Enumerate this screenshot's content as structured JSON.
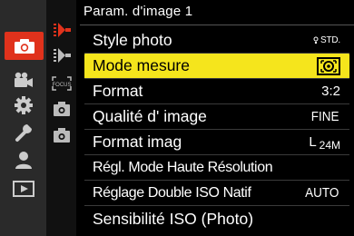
{
  "header": {
    "title": "Param. d'image 1"
  },
  "main_tabs": [
    {
      "icon": "camera-icon",
      "active": true
    },
    {
      "icon": "movie-camera-icon",
      "active": false
    },
    {
      "icon": "gear-icon",
      "active": false
    },
    {
      "icon": "wrench-icon",
      "active": false
    },
    {
      "icon": "person-icon",
      "active": false
    },
    {
      "icon": "playback-icon",
      "active": false
    }
  ],
  "sub_tabs": [
    {
      "icon": "image-settings-1-icon",
      "active": true
    },
    {
      "icon": "image-settings-2-icon",
      "active": false
    },
    {
      "icon": "focus-icon",
      "label": "FOCUS"
    },
    {
      "icon": "camera-small-icon",
      "active": false
    },
    {
      "icon": "camera-small-2-icon",
      "active": false
    }
  ],
  "menu": {
    "items": [
      {
        "label": "Style photo",
        "value": "STD."
      },
      {
        "label": "Mode mesure",
        "value_icon": "metering-icon"
      },
      {
        "label": "Format",
        "value": "3:2"
      },
      {
        "label": "Qualité d' image",
        "value": "FINE"
      },
      {
        "label": "Format imag",
        "value": "L",
        "value_sub": "24M"
      },
      {
        "label": "Régl. Mode Haute Résolution",
        "value": ""
      },
      {
        "label": "Réglage Double ISO Natif",
        "value": "AUTO"
      },
      {
        "label": "Sensibilité ISO (Photo)",
        "value": ""
      }
    ]
  },
  "colors": {
    "accent": "#e0321c",
    "highlight": "#f5e51c",
    "background": "#000000"
  }
}
